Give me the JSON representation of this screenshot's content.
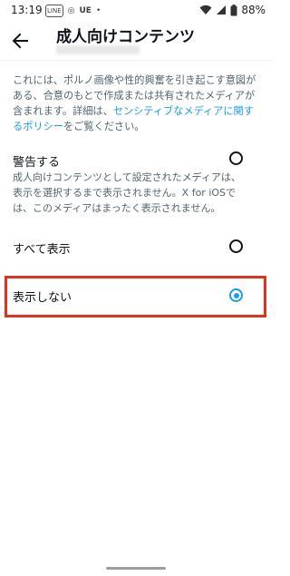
{
  "status_bar": {
    "time": "13:19",
    "left_icons": [
      "LINE",
      "◎",
      "UE",
      "•"
    ],
    "battery": "88%"
  },
  "header": {
    "title": "成人向けコンテンツ"
  },
  "description": {
    "text_before": "これには、ポルノ画像や性的興奮を引き起こす意図がある、合意のもとで作成または共有されたメディアが含まれます。詳細は、",
    "link": "センシティブなメディアに関するポリシー",
    "text_after": "をご覧ください。"
  },
  "options": [
    {
      "label": "警告する",
      "help": "成人向けコンテンツとして設定されたメディアは、表示を選択するまで表示されません。X for iOSでは、このメディアはまったく表示されません。",
      "selected": false
    },
    {
      "label": "すべて表示",
      "help": "",
      "selected": false
    },
    {
      "label": "表示しない",
      "help": "",
      "selected": true
    }
  ],
  "colors": {
    "accent": "#1d9bf0",
    "highlight_border": "#e0301e"
  }
}
